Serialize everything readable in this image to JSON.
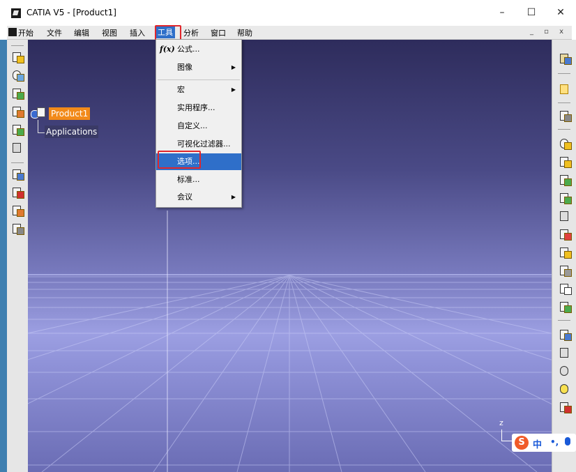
{
  "window": {
    "title": "CATIA V5 - [Product1]",
    "minimize": "–",
    "maximize": "☐",
    "close": "✕",
    "mdi_controls": "_ ▫ x"
  },
  "menubar": [
    "开始",
    "文件",
    "编辑",
    "视图",
    "插入",
    "工具",
    "分析",
    "窗口",
    "帮助"
  ],
  "active_menu": "工具",
  "tools_menu": {
    "items": [
      {
        "label": "公式...",
        "icon": "formula-icon",
        "icon_text": "f(x)",
        "has_submenu": false
      },
      {
        "label": "图像",
        "has_submenu": true
      },
      {
        "label": "宏",
        "has_submenu": true
      },
      {
        "label": "实用程序...",
        "has_submenu": false
      },
      {
        "label": "自定义...",
        "has_submenu": false
      },
      {
        "label": "可视化过滤器...",
        "has_submenu": false
      },
      {
        "label": "选项...",
        "has_submenu": false,
        "selected": true
      },
      {
        "label": "标准...",
        "has_submenu": false
      },
      {
        "label": "会议",
        "has_submenu": true
      }
    ],
    "submenu_arrow": "▶"
  },
  "tree": {
    "root": "Product1",
    "child": "Applications"
  },
  "axis": {
    "label": "z"
  },
  "ime": {
    "lang": "中",
    "punct": "•,"
  },
  "colors": {
    "highlight": "#2f6fc9",
    "annotation_red": "#e0262b",
    "tree_root": "#f28a1a"
  }
}
